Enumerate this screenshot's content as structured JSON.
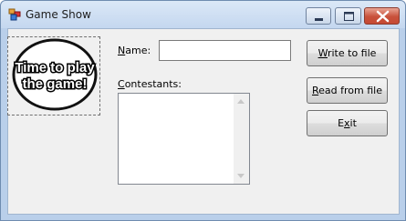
{
  "window": {
    "title": "Game Show",
    "controls": [
      "minimize",
      "maximize",
      "close"
    ]
  },
  "picture": {
    "icon": "speech-bubble-logo",
    "line1": "Time to play",
    "line2": "the game!"
  },
  "form": {
    "name_label_first": "N",
    "name_label_rest": "ame:",
    "name_value": "",
    "contestants_label_first": "C",
    "contestants_label_rest": "ontestants:",
    "contestants_items": []
  },
  "buttons": {
    "write": {
      "first": "W",
      "rest": "rite to file"
    },
    "read": {
      "first": "R",
      "rest": "ead from file"
    },
    "exit": {
      "pre": "E",
      "mnemonic": "x",
      "post": "it"
    }
  },
  "colors": {
    "close_button": "#c64a34",
    "client_bg": "#f0f0f0"
  }
}
